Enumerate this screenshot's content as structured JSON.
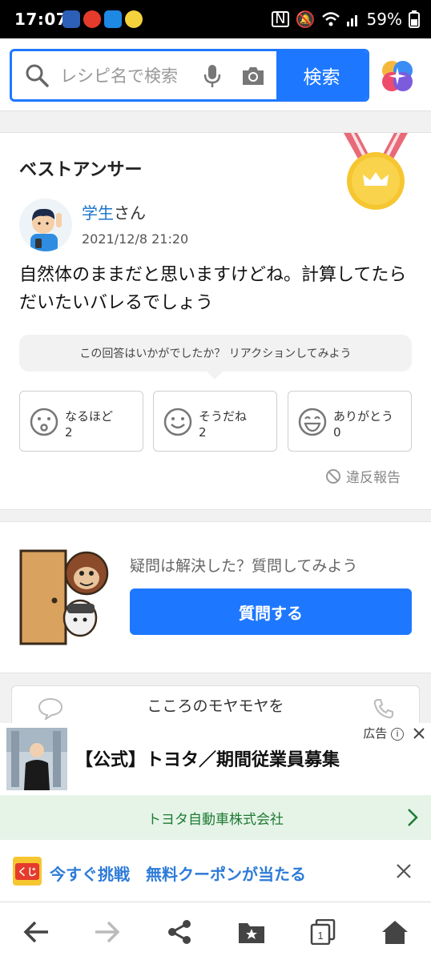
{
  "status_bar": {
    "time": "17:07",
    "battery": "59%"
  },
  "search": {
    "placeholder": "レシピ名で検索",
    "button_label": "検索"
  },
  "best_answer": {
    "heading": "ベストアンサー",
    "user_name": "学生",
    "user_suffix": "さん",
    "date": "2021/12/8 21:20",
    "text": "自然体のままだと思いますけどね。計算してたらだいたいバレるでしょう",
    "prompt": "この回答はいかがでしたか？ リアクションしてみよう",
    "reactions": [
      {
        "label": "なるほど",
        "count": "2"
      },
      {
        "label": "そうだね",
        "count": "2"
      },
      {
        "label": "ありがとう",
        "count": "0"
      }
    ],
    "report_label": "違反報告"
  },
  "ask": {
    "text": "疑問は解決した？質問してみよう",
    "button_label": "質問する"
  },
  "consult": {
    "line1": "こころのモヤモヤを"
  },
  "ad": {
    "label": "広告",
    "title": "【公式】トヨタ／期間従業員募集",
    "advertiser": "トヨタ自動車株式会社"
  },
  "promo": {
    "text": "今すぐ挑戦　無料クーポンが当たる",
    "logo_text": "くじ"
  },
  "colors": {
    "accent": "#1e78ff",
    "link": "#1a73c9",
    "ad_green": "#1e7a32"
  }
}
